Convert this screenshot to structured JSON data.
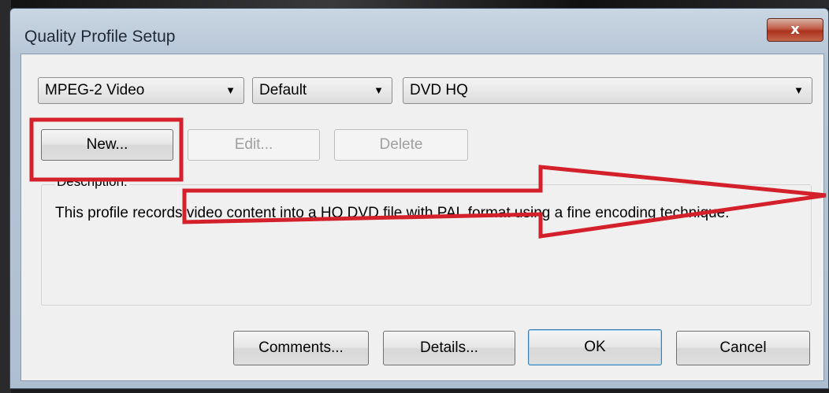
{
  "window": {
    "title": "Quality Profile Setup",
    "close_glyph": "x"
  },
  "selectors": {
    "codec": "MPEG-2 Video",
    "preset": "Default",
    "profile": "DVD HQ",
    "arrow_glyph": "▼"
  },
  "profile_buttons": {
    "new_label": "New...",
    "edit_label": "Edit...",
    "delete_label": "Delete"
  },
  "description": {
    "label": "Description:",
    "text": "This profile records video content into a HQ DVD file with PAL format using a fine encoding technique."
  },
  "footer_buttons": {
    "comments_label": "Comments...",
    "details_label": "Details...",
    "ok_label": "OK",
    "cancel_label": "Cancel"
  },
  "annotation": {
    "color": "#d4202a",
    "shapes": [
      "highlight-box",
      "arrow-right"
    ]
  }
}
